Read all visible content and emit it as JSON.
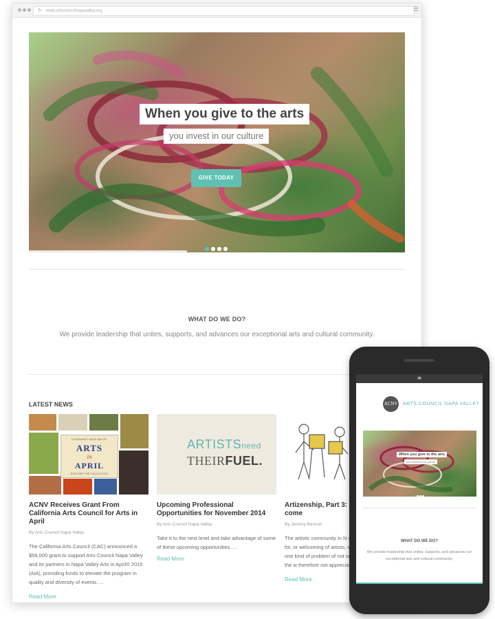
{
  "browser": {
    "url": "www.artscouncilnapavalley.org"
  },
  "hero": {
    "title": "When you give to the arts",
    "subtitle": "you invest in our culture",
    "cta": "GIVE TODAY",
    "slides_count": 4,
    "active_slide": 1
  },
  "what": {
    "title": "WHAT DO WE DO?",
    "text": "We provide leadership that unites, supports, and advances our exceptional arts and cultural community."
  },
  "news": {
    "heading": "LATEST NEWS",
    "items": [
      {
        "title": "ACNV Receives Grant From California Arts Council for Arts in April",
        "author": "By Arts Council Napa Valley",
        "excerpt": "The California Arts Council (CAC) announced a $56,000 grant to support Arts Council Napa Valley and its partners in Napa Valley Arts in April® 2015 (AiA), providing funds to elevate the program in quality and diversity of events. ...",
        "read_more": "Read More",
        "image": {
          "line1": "LEGENDARY NAPA VALLEY",
          "line2": "ARTS",
          "line3": "in",
          "line4": "APRIL",
          "line5": "EXPLORE THE COLLECTION"
        }
      },
      {
        "title": "Upcoming Professional Opportunities for November 2014",
        "author": "By Arts Council Napa Valley",
        "excerpt": "Take it to the next level and take advantage of some of these upcoming opportunities. ...",
        "read_more": "Read More",
        "image": {
          "line1": "ARTISTS",
          "line1b": "need",
          "line2": "THEIR",
          "line2b": "FUEL."
        }
      },
      {
        "title": "Artizenship, Part 3: Buil come",
        "author": "By Jeremy Benson",
        "excerpt": "The artistic community in N suited for, or welcoming of artists, who live one kind of problem of not seeing the w therefore not appreciating",
        "read_more": "Read More"
      }
    ]
  },
  "phone": {
    "logo": "ACNV",
    "name": "ARTS COUNCIL NAPA VALLEY",
    "hero_title": "When you give to the arts",
    "hero_subtitle": "you invest in our culture",
    "what_title": "WHAT DO WE DO?",
    "what_text": "We provide leadership that unites, supports, and advances our exceptional arts and cultural community."
  },
  "colors": {
    "accent": "#5fc1b3",
    "heading": "#444444",
    "body_text": "#666666"
  }
}
